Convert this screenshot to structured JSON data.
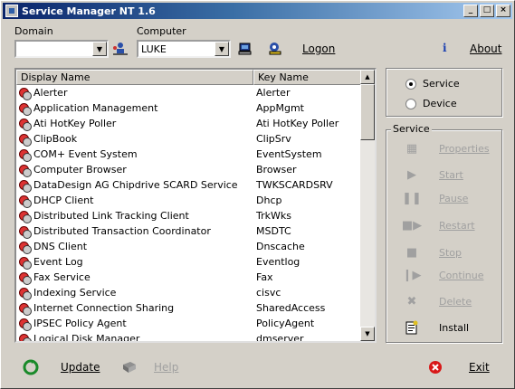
{
  "window": {
    "title": "Service Manager NT 1.6",
    "minimize": "_",
    "maximize": "□",
    "close": "×"
  },
  "top": {
    "domain_label": "Domain",
    "domain_value": "",
    "computer_label": "Computer",
    "computer_value": "LUKE",
    "logon_label": "Logon",
    "about_label": "About",
    "info_glyph": "i"
  },
  "list": {
    "columns": [
      "Display Name",
      "Key Name"
    ],
    "rows": [
      {
        "name": "Alerter",
        "key": "Alerter"
      },
      {
        "name": "Application Management",
        "key": "AppMgmt"
      },
      {
        "name": "Ati HotKey Poller",
        "key": "Ati HotKey Poller"
      },
      {
        "name": "ClipBook",
        "key": "ClipSrv"
      },
      {
        "name": "COM+ Event System",
        "key": "EventSystem"
      },
      {
        "name": "Computer Browser",
        "key": "Browser"
      },
      {
        "name": "DataDesign AG Chipdrive SCARD Service",
        "key": "TWKSCARDSRV"
      },
      {
        "name": "DHCP Client",
        "key": "Dhcp"
      },
      {
        "name": "Distributed Link Tracking Client",
        "key": "TrkWks"
      },
      {
        "name": "Distributed Transaction Coordinator",
        "key": "MSDTC"
      },
      {
        "name": "DNS Client",
        "key": "Dnscache"
      },
      {
        "name": "Event Log",
        "key": "Eventlog"
      },
      {
        "name": "Fax Service",
        "key": "Fax"
      },
      {
        "name": "Indexing Service",
        "key": "cisvc"
      },
      {
        "name": "Internet Connection Sharing",
        "key": "SharedAccess"
      },
      {
        "name": "IPSEC Policy Agent",
        "key": "PolicyAgent"
      },
      {
        "name": "Logical Disk Manager",
        "key": "dmserver"
      }
    ]
  },
  "mode": {
    "service_label": "Service",
    "device_label": "Device",
    "selected": "Service"
  },
  "service_group": {
    "title": "Service",
    "buttons": [
      {
        "label": "Properties",
        "enabled": false
      },
      {
        "label": "Start",
        "enabled": false
      },
      {
        "label": "Pause",
        "enabled": false
      },
      {
        "label": "Restart",
        "enabled": false
      },
      {
        "label": "Stop",
        "enabled": false
      },
      {
        "label": "Continue",
        "enabled": false
      },
      {
        "label": "Delete",
        "enabled": false
      },
      {
        "label": "Install",
        "enabled": true
      }
    ]
  },
  "bottom": {
    "update_label": "Update",
    "help_label": "Help",
    "exit_label": "Exit"
  },
  "colors": {
    "title_start": "#0a246a",
    "title_end": "#a6caf0",
    "face": "#d4d0c8",
    "disabled": "#a0a0a0"
  }
}
